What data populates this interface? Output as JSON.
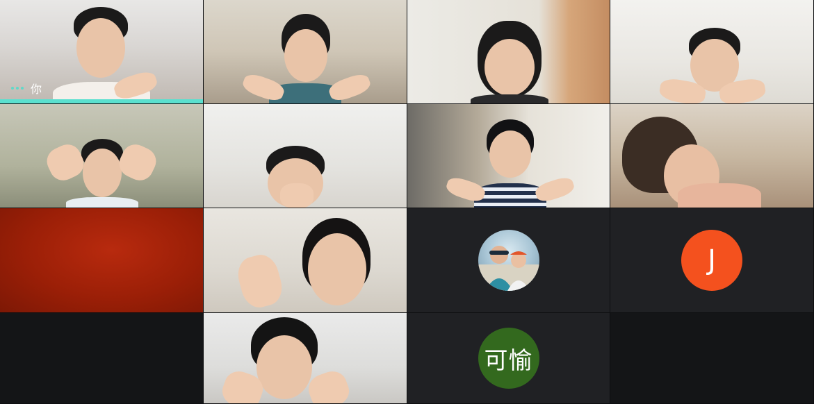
{
  "app": {
    "accent": "#5ae0cf"
  },
  "self_tile": {
    "name_label": "你"
  },
  "avatars": {
    "j": {
      "initial": "J",
      "color": "#f4511e"
    },
    "keyu": {
      "initial": "可愉",
      "color": "#33691e"
    }
  }
}
